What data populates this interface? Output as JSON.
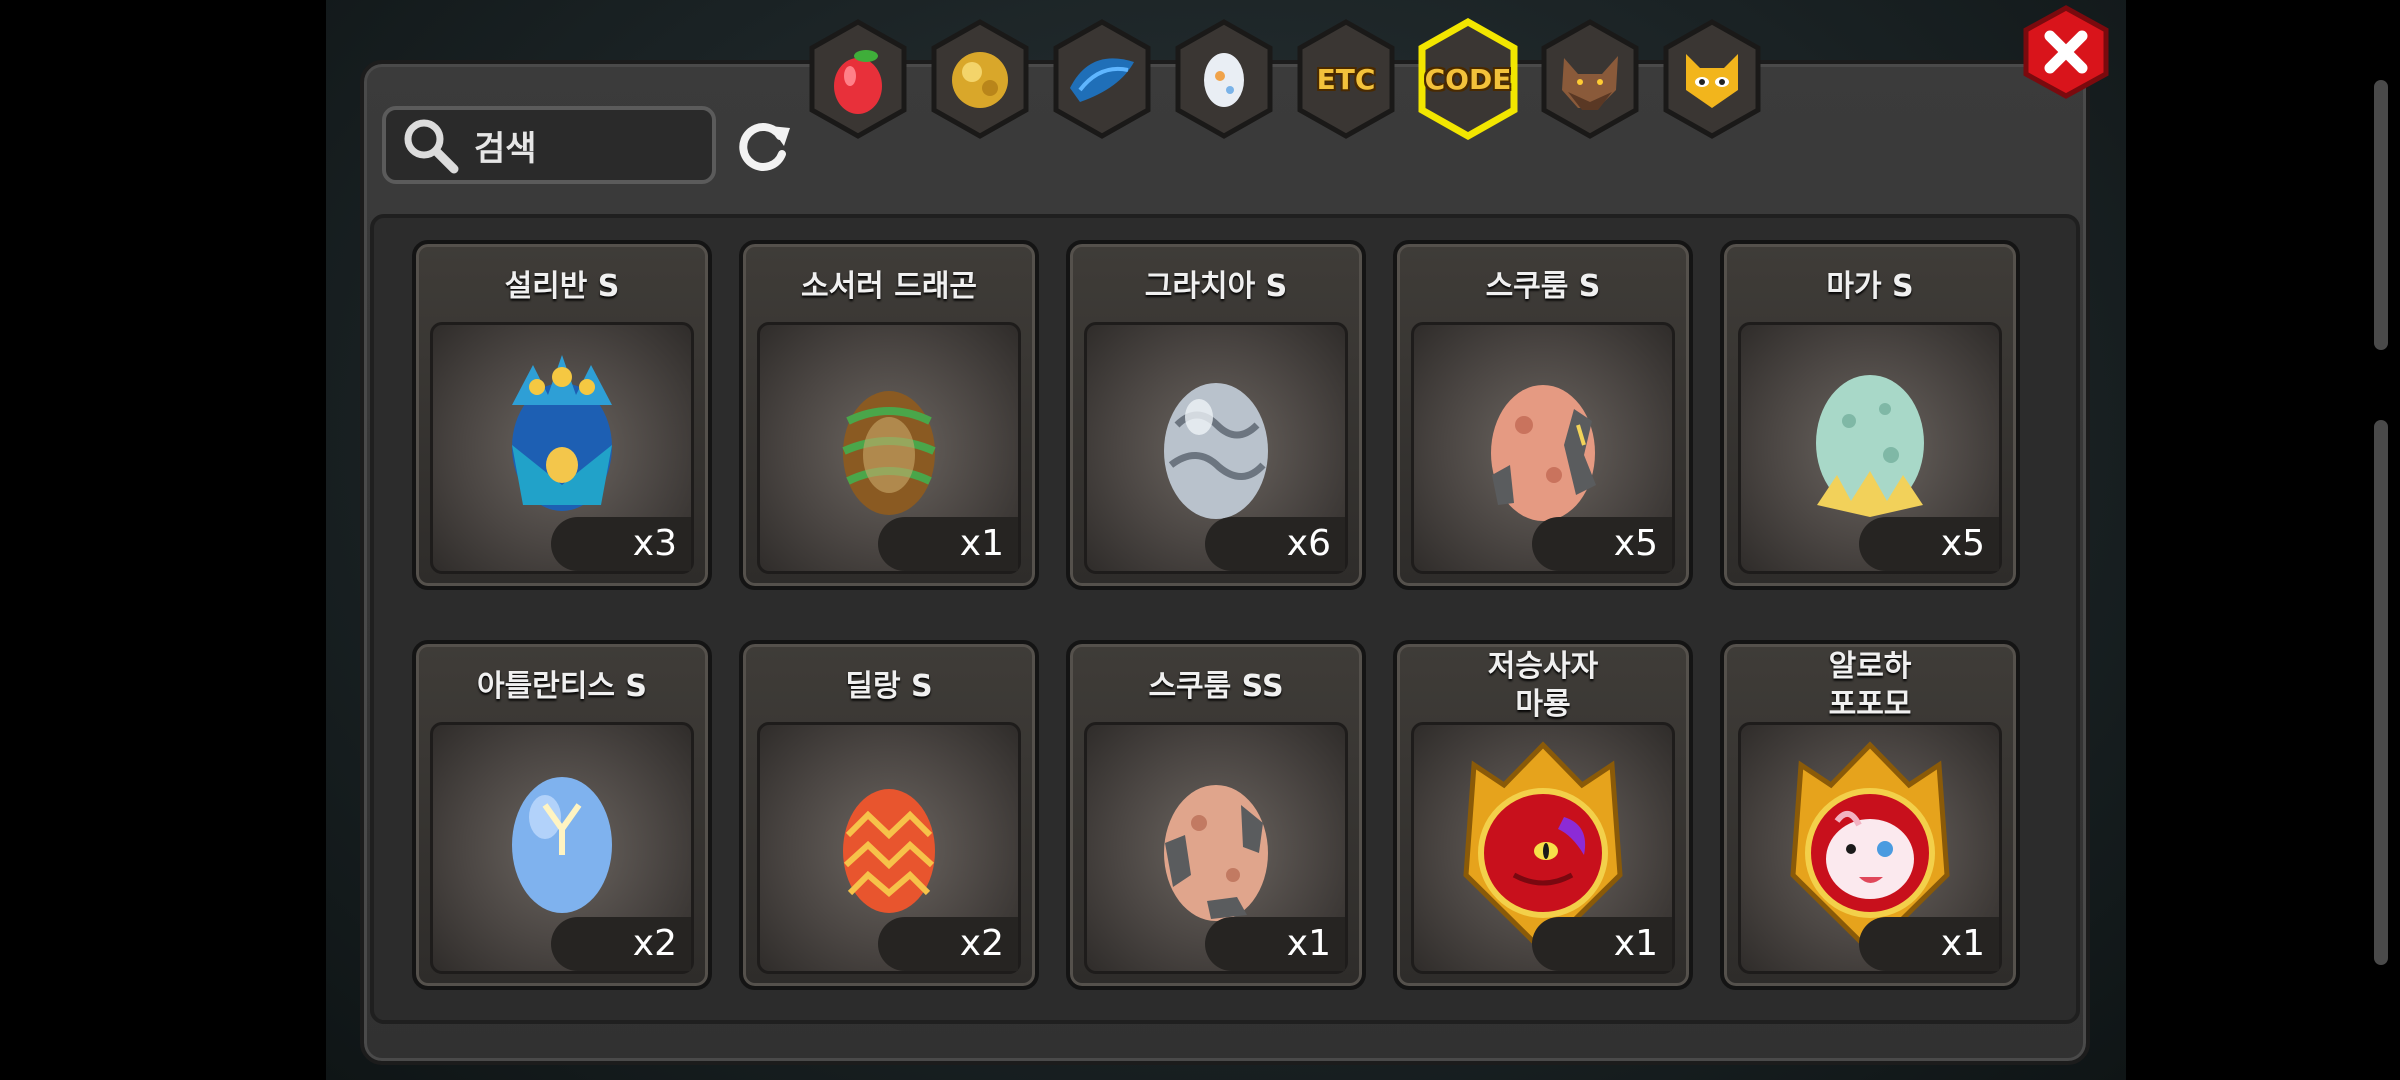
{
  "search": {
    "placeholder": "검색"
  },
  "tabs": [
    {
      "icon": "fruit-icon",
      "label": ""
    },
    {
      "icon": "gold-nugget-icon",
      "label": ""
    },
    {
      "icon": "dragon-wing-icon",
      "label": ""
    },
    {
      "icon": "egg-icon",
      "label": ""
    },
    {
      "icon": "etc-icon",
      "label": "ETC"
    },
    {
      "icon": "code-icon",
      "label": "CODE",
      "selected": true
    },
    {
      "icon": "werewolf-icon",
      "label": ""
    },
    {
      "icon": "monster-face-icon",
      "label": ""
    }
  ],
  "items": [
    {
      "name": "설리반 S",
      "qty": "x3",
      "icon": "peacock-egg-icon"
    },
    {
      "name": "소서러 드래곤",
      "qty": "x1",
      "icon": "striped-egg-icon"
    },
    {
      "name": "그라치아 S",
      "qty": "x6",
      "icon": "silver-egg-icon"
    },
    {
      "name": "스쿠룸 S",
      "qty": "x5",
      "icon": "cracked-egg-icon"
    },
    {
      "name": "마가 S",
      "qty": "x5",
      "icon": "mint-egg-icon"
    },
    {
      "name": "아틀란티스 S",
      "qty": "x2",
      "icon": "blue-egg-icon"
    },
    {
      "name": "딜랑 S",
      "qty": "x2",
      "icon": "orange-egg-icon"
    },
    {
      "name": "스쿠룸 SS",
      "qty": "x1",
      "icon": "cracked-egg-icon"
    },
    {
      "name": "저승사자\n마룡",
      "qty": "x1",
      "icon": "red-dragon-badge-icon"
    },
    {
      "name": "알로하\n포포모",
      "qty": "x1",
      "icon": "white-dragon-badge-icon"
    }
  ],
  "colors": {
    "tab_selected_border": "#f2e600",
    "tab_label": "#f3c23b",
    "close_button": "#d9141b"
  }
}
